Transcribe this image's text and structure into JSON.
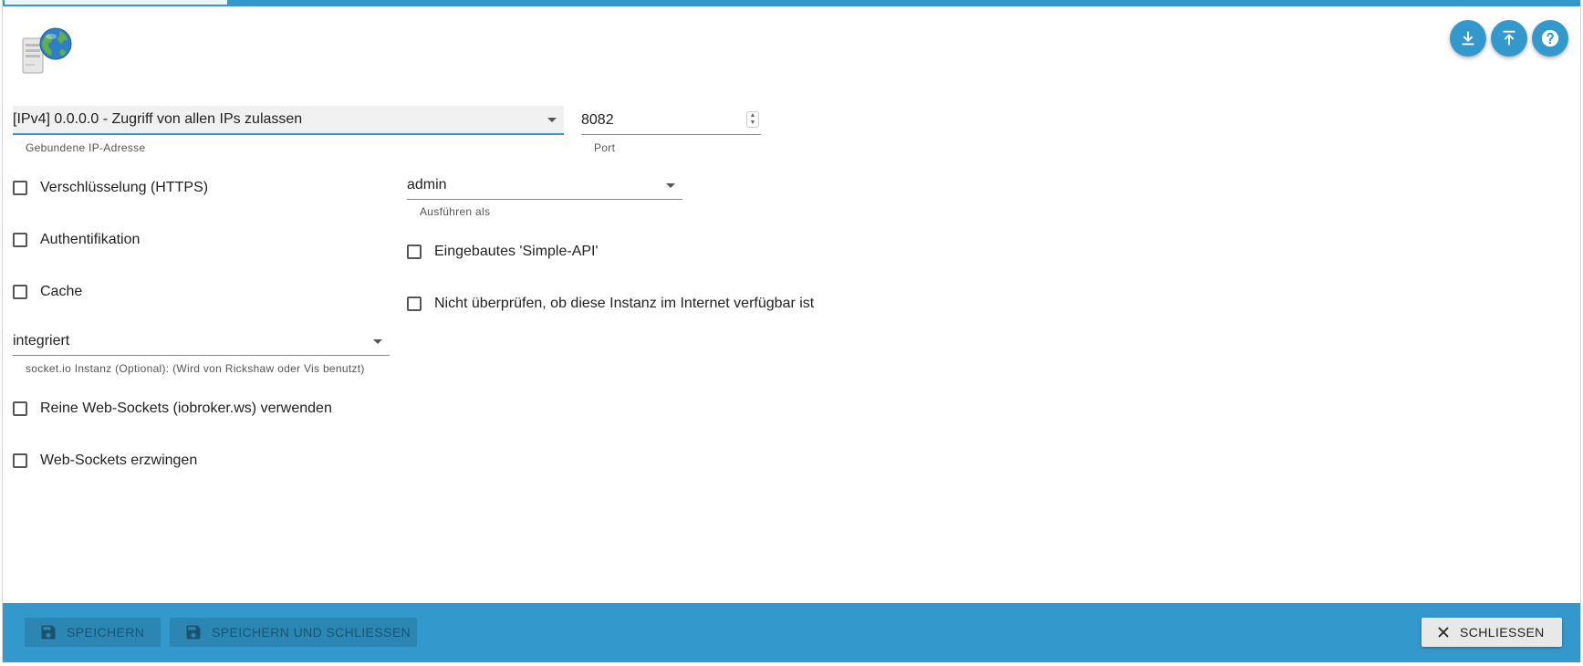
{
  "header": {
    "logo_icon": "server-globe-icon",
    "actions": [
      {
        "icon": "download-icon"
      },
      {
        "icon": "upload-icon"
      },
      {
        "icon": "help-icon"
      }
    ]
  },
  "form": {
    "bind_ip": {
      "value": "[IPv4] 0.0.0.0 - Zugriff von allen IPs zulassen",
      "label": "Gebundene IP-Adresse"
    },
    "port": {
      "value": "8082",
      "label": "Port"
    },
    "run_as": {
      "value": "admin",
      "label": "Ausführen als"
    },
    "socketio": {
      "value": "integriert",
      "label": "socket.io Instanz (Optional): (Wird von Rickshaw oder Vis benutzt)"
    },
    "checkboxes": {
      "https": "Verschlüsselung (HTTPS)",
      "auth": "Authentifikation",
      "cache": "Cache",
      "simple_api": "Eingebautes 'Simple-API'",
      "no_check": "Nicht überprüfen, ob diese Instanz im Internet verfügbar ist",
      "pure_ws": "Reine Web-Sockets (iobroker.ws) verwenden",
      "force_ws": "Web-Sockets erzwingen"
    }
  },
  "footer": {
    "save_label": "SPEICHERN",
    "save_close_label": "SPEICHERN UND SCHLIESSEN",
    "close_label": "SCHLIESSEN"
  },
  "colors": {
    "accent": "#3399cc"
  }
}
